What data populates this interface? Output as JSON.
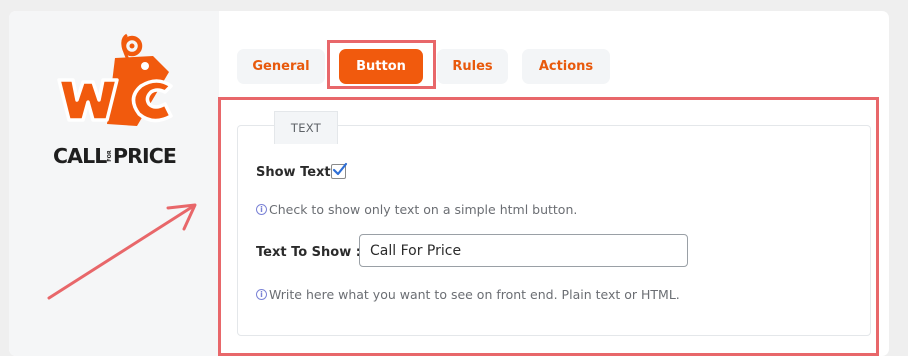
{
  "logo": {
    "mark_letters": "WC",
    "text_left": "CALL",
    "text_small": "FOR",
    "text_right": "PRICE",
    "brand_color": "#f15a0d"
  },
  "tabs": [
    {
      "label": "General",
      "active": false
    },
    {
      "label": "Button",
      "active": true
    },
    {
      "label": "Rules",
      "active": false
    },
    {
      "label": "Actions",
      "active": false
    }
  ],
  "panel": {
    "section_tab": "TEXT",
    "show_text": {
      "label": "Show Text",
      "checked": true,
      "hint": "Check to show only text on a simple html button."
    },
    "text_to_show": {
      "label": "Text To Show :",
      "value": "Call For Price",
      "hint": "Write here what you want to see on front end. Plain text or HTML."
    }
  },
  "icons": {
    "info": "info-icon",
    "check": "checkmark-icon"
  },
  "colors": {
    "accent": "#f15a0d",
    "highlight": "#e8676a",
    "info": "#7b83d6"
  }
}
